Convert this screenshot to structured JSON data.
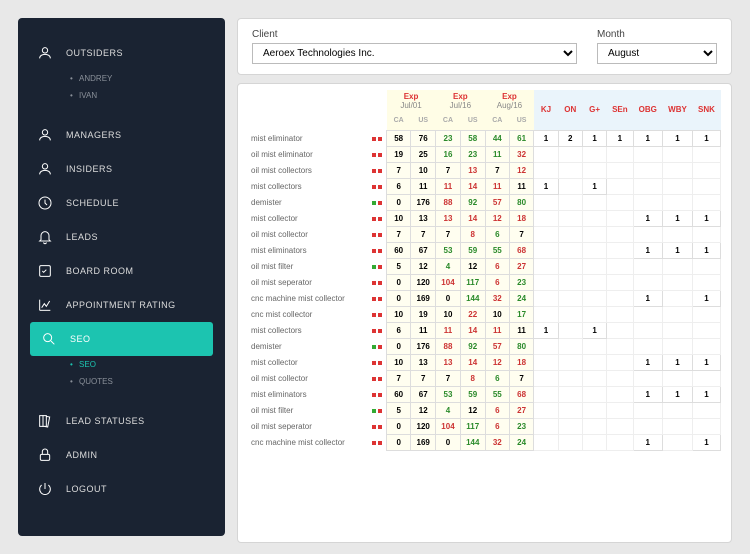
{
  "sidebar": {
    "outsiders": {
      "label": "OUTSIDERS",
      "subs": [
        "ANDREY",
        "IVAN"
      ]
    },
    "items": [
      {
        "label": "MANAGERS",
        "icon": "user"
      },
      {
        "label": "INSIDERS",
        "icon": "user"
      },
      {
        "label": "SCHEDULE",
        "icon": "clock"
      },
      {
        "label": "LEADS",
        "icon": "bell"
      },
      {
        "label": "BOARD ROOM",
        "icon": "edit"
      },
      {
        "label": "APPOINTMENT RATING",
        "icon": "chart"
      }
    ],
    "seo": {
      "label": "SEO",
      "icon": "search",
      "subs": [
        {
          "label": "SEO",
          "on": true
        },
        {
          "label": "QUOTES",
          "on": false
        }
      ]
    },
    "bottom": [
      {
        "label": "LEAD STATUSES",
        "icon": "books"
      },
      {
        "label": "ADMIN",
        "icon": "lock"
      },
      {
        "label": "LOGOUT",
        "icon": "power"
      }
    ]
  },
  "filters": {
    "client": {
      "label": "Client",
      "value": "Aeroex Technologies Inc."
    },
    "month": {
      "label": "Month",
      "value": "August"
    }
  },
  "columns": {
    "exp": [
      {
        "t": "Exp",
        "s": "Jul/01"
      },
      {
        "t": "Exp",
        "s": "Jul/16"
      },
      {
        "t": "Exp",
        "s": "Aug/16"
      }
    ],
    "sub": [
      "CA",
      "US"
    ],
    "metrics": [
      "KJ",
      "ON",
      "G+",
      "SEn",
      "OBG",
      "WBY",
      "SNK"
    ]
  },
  "rows": [
    {
      "n": "mist eliminator",
      "d": "rr",
      "e": [
        [
          "58",
          "76"
        ],
        [
          "23",
          "58"
        ],
        [
          "44",
          "61"
        ]
      ],
      "m": [
        "1",
        "2",
        "1",
        "1",
        "1",
        "1",
        "1"
      ]
    },
    {
      "n": "oil mist eliminator",
      "d": "rr",
      "e": [
        [
          "19",
          "25"
        ],
        [
          "16",
          "23"
        ],
        [
          "11",
          "32"
        ]
      ],
      "m": [
        "",
        "",
        "",
        "",
        "",
        "",
        ""
      ]
    },
    {
      "n": "oil mist collectors",
      "d": "rr",
      "e": [
        [
          "7",
          "10"
        ],
        [
          "7",
          "13"
        ],
        [
          "7",
          "12"
        ]
      ],
      "m": [
        "",
        "",
        "",
        "",
        "",
        "",
        ""
      ]
    },
    {
      "n": "mist collectors",
      "d": "rr",
      "e": [
        [
          "6",
          "11"
        ],
        [
          "11",
          "14"
        ],
        [
          "11",
          "11"
        ]
      ],
      "m": [
        "1",
        "",
        "1",
        "",
        "",
        "",
        ""
      ]
    },
    {
      "n": "demister",
      "d": "gr",
      "e": [
        [
          "0",
          "176"
        ],
        [
          "88",
          "92"
        ],
        [
          "57",
          "80"
        ]
      ],
      "m": [
        "",
        "",
        "",
        "",
        "",
        "",
        ""
      ]
    },
    {
      "n": "mist collector",
      "d": "rr",
      "e": [
        [
          "10",
          "13"
        ],
        [
          "13",
          "14"
        ],
        [
          "12",
          "18"
        ]
      ],
      "m": [
        "",
        "",
        "",
        "",
        "1",
        "1",
        "1"
      ]
    },
    {
      "n": "oil mist collector",
      "d": "rr",
      "e": [
        [
          "7",
          "7"
        ],
        [
          "7",
          "8"
        ],
        [
          "6",
          "7"
        ]
      ],
      "m": [
        "",
        "",
        "",
        "",
        "",
        "",
        ""
      ]
    },
    {
      "n": "mist eliminators",
      "d": "rr",
      "e": [
        [
          "60",
          "67"
        ],
        [
          "53",
          "59"
        ],
        [
          "55",
          "68"
        ]
      ],
      "m": [
        "",
        "",
        "",
        "",
        "1",
        "1",
        "1"
      ]
    },
    {
      "n": "oil mist filter",
      "d": "gr",
      "e": [
        [
          "5",
          "12"
        ],
        [
          "4",
          "12"
        ],
        [
          "6",
          "27"
        ]
      ],
      "m": [
        "",
        "",
        "",
        "",
        "",
        "",
        ""
      ]
    },
    {
      "n": "oil mist seperator",
      "d": "rr",
      "e": [
        [
          "0",
          "120"
        ],
        [
          "104",
          "117"
        ],
        [
          "6",
          "23"
        ]
      ],
      "m": [
        "",
        "",
        "",
        "",
        "",
        "",
        ""
      ]
    },
    {
      "n": "cnc machine mist collector",
      "d": "rr",
      "e": [
        [
          "0",
          "169"
        ],
        [
          "0",
          "144"
        ],
        [
          "32",
          "24"
        ]
      ],
      "m": [
        "",
        "",
        "",
        "",
        "1",
        "",
        "1"
      ]
    },
    {
      "n": "cnc mist collector",
      "d": "rr",
      "e": [
        [
          "10",
          "19"
        ],
        [
          "10",
          "22"
        ],
        [
          "10",
          "17"
        ]
      ],
      "m": [
        "",
        "",
        "",
        "",
        "",
        "",
        ""
      ]
    },
    {
      "n": "mist collectors",
      "d": "rr",
      "e": [
        [
          "6",
          "11"
        ],
        [
          "11",
          "14"
        ],
        [
          "11",
          "11"
        ]
      ],
      "m": [
        "1",
        "",
        "1",
        "",
        "",
        "",
        ""
      ]
    },
    {
      "n": "demister",
      "d": "gr",
      "e": [
        [
          "0",
          "176"
        ],
        [
          "88",
          "92"
        ],
        [
          "57",
          "80"
        ]
      ],
      "m": [
        "",
        "",
        "",
        "",
        "",
        "",
        ""
      ]
    },
    {
      "n": "mist collector",
      "d": "rr",
      "e": [
        [
          "10",
          "13"
        ],
        [
          "13",
          "14"
        ],
        [
          "12",
          "18"
        ]
      ],
      "m": [
        "",
        "",
        "",
        "",
        "1",
        "1",
        "1"
      ]
    },
    {
      "n": "oil mist collector",
      "d": "rr",
      "e": [
        [
          "7",
          "7"
        ],
        [
          "7",
          "8"
        ],
        [
          "6",
          "7"
        ]
      ],
      "m": [
        "",
        "",
        "",
        "",
        "",
        "",
        ""
      ]
    },
    {
      "n": "mist eliminators",
      "d": "rr",
      "e": [
        [
          "60",
          "67"
        ],
        [
          "53",
          "59"
        ],
        [
          "55",
          "68"
        ]
      ],
      "m": [
        "",
        "",
        "",
        "",
        "1",
        "1",
        "1"
      ]
    },
    {
      "n": "oil mist filter",
      "d": "gr",
      "e": [
        [
          "5",
          "12"
        ],
        [
          "4",
          "12"
        ],
        [
          "6",
          "27"
        ]
      ],
      "m": [
        "",
        "",
        "",
        "",
        "",
        "",
        ""
      ]
    },
    {
      "n": "oil mist seperator",
      "d": "rr",
      "e": [
        [
          "0",
          "120"
        ],
        [
          "104",
          "117"
        ],
        [
          "6",
          "23"
        ]
      ],
      "m": [
        "",
        "",
        "",
        "",
        "",
        "",
        ""
      ]
    },
    {
      "n": "cnc machine mist collector",
      "d": "rr",
      "e": [
        [
          "0",
          "169"
        ],
        [
          "0",
          "144"
        ],
        [
          "32",
          "24"
        ]
      ],
      "m": [
        "",
        "",
        "",
        "",
        "1",
        "",
        "1"
      ]
    }
  ]
}
